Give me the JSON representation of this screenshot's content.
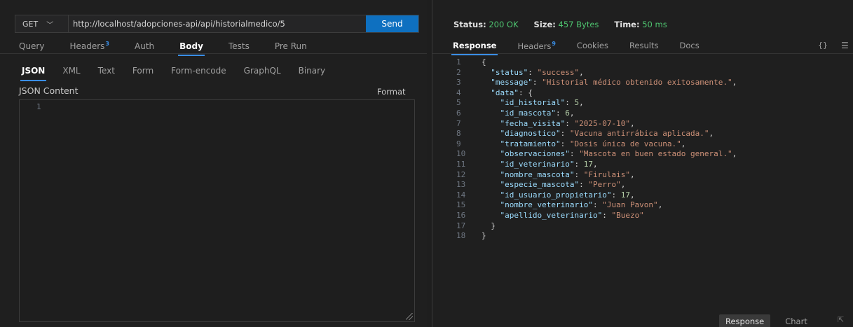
{
  "request": {
    "method": "GET",
    "url": "http://localhost/adopciones-api/api/historialmedico/5",
    "send_label": "Send",
    "tabs": [
      {
        "label": "Query"
      },
      {
        "label": "Headers",
        "badge": "3"
      },
      {
        "label": "Auth"
      },
      {
        "label": "Body",
        "active": true
      },
      {
        "label": "Tests"
      },
      {
        "label": "Pre Run"
      }
    ],
    "body_tabs": [
      {
        "label": "JSON",
        "active": true
      },
      {
        "label": "XML"
      },
      {
        "label": "Text"
      },
      {
        "label": "Form"
      },
      {
        "label": "Form-encode"
      },
      {
        "label": "GraphQL"
      },
      {
        "label": "Binary"
      }
    ],
    "json_content_label": "JSON Content",
    "format_label": "Format",
    "editor_line_number": "1"
  },
  "response": {
    "status_label": "Status:",
    "status_value": "200 OK",
    "size_label": "Size:",
    "size_value": "457 Bytes",
    "time_label": "Time:",
    "time_value": "50 ms",
    "tabs": [
      {
        "label": "Response",
        "active": true
      },
      {
        "label": "Headers",
        "badge": "9"
      },
      {
        "label": "Cookies"
      },
      {
        "label": "Results"
      },
      {
        "label": "Docs"
      }
    ],
    "braces_icon": "{}",
    "menu_icon": "hamburger-icon",
    "bottom_tabs": [
      {
        "label": "Response",
        "active": true
      },
      {
        "label": "Chart"
      }
    ],
    "body_lines": [
      {
        "n": "1",
        "indent": 0,
        "tokens": [
          {
            "t": "p",
            "v": "{"
          }
        ]
      },
      {
        "n": "2",
        "indent": 1,
        "tokens": [
          {
            "t": "k",
            "v": "\"status\""
          },
          {
            "t": "p",
            "v": ": "
          },
          {
            "t": "s",
            "v": "\"success\""
          },
          {
            "t": "p",
            "v": ","
          }
        ]
      },
      {
        "n": "3",
        "indent": 1,
        "tokens": [
          {
            "t": "k",
            "v": "\"message\""
          },
          {
            "t": "p",
            "v": ": "
          },
          {
            "t": "s",
            "v": "\"Historial médico obtenido exitosamente.\""
          },
          {
            "t": "p",
            "v": ","
          }
        ]
      },
      {
        "n": "4",
        "indent": 1,
        "tokens": [
          {
            "t": "k",
            "v": "\"data\""
          },
          {
            "t": "p",
            "v": ": {"
          }
        ]
      },
      {
        "n": "5",
        "indent": 2,
        "tokens": [
          {
            "t": "k",
            "v": "\"id_historial\""
          },
          {
            "t": "p",
            "v": ": "
          },
          {
            "t": "num",
            "v": "5"
          },
          {
            "t": "p",
            "v": ","
          }
        ]
      },
      {
        "n": "6",
        "indent": 2,
        "tokens": [
          {
            "t": "k",
            "v": "\"id_mascota\""
          },
          {
            "t": "p",
            "v": ": "
          },
          {
            "t": "num",
            "v": "6"
          },
          {
            "t": "p",
            "v": ","
          }
        ]
      },
      {
        "n": "7",
        "indent": 2,
        "tokens": [
          {
            "t": "k",
            "v": "\"fecha_visita\""
          },
          {
            "t": "p",
            "v": ": "
          },
          {
            "t": "s",
            "v": "\"2025-07-10\""
          },
          {
            "t": "p",
            "v": ","
          }
        ]
      },
      {
        "n": "8",
        "indent": 2,
        "tokens": [
          {
            "t": "k",
            "v": "\"diagnostico\""
          },
          {
            "t": "p",
            "v": ": "
          },
          {
            "t": "s",
            "v": "\"Vacuna antirrábica aplicada.\""
          },
          {
            "t": "p",
            "v": ","
          }
        ]
      },
      {
        "n": "9",
        "indent": 2,
        "tokens": [
          {
            "t": "k",
            "v": "\"tratamiento\""
          },
          {
            "t": "p",
            "v": ": "
          },
          {
            "t": "s",
            "v": "\"Dosis única de vacuna.\""
          },
          {
            "t": "p",
            "v": ","
          }
        ]
      },
      {
        "n": "10",
        "indent": 2,
        "tokens": [
          {
            "t": "k",
            "v": "\"observaciones\""
          },
          {
            "t": "p",
            "v": ": "
          },
          {
            "t": "s",
            "v": "\"Mascota en buen estado general.\""
          },
          {
            "t": "p",
            "v": ","
          }
        ]
      },
      {
        "n": "11",
        "indent": 2,
        "tokens": [
          {
            "t": "k",
            "v": "\"id_veterinario\""
          },
          {
            "t": "p",
            "v": ": "
          },
          {
            "t": "num",
            "v": "17"
          },
          {
            "t": "p",
            "v": ","
          }
        ]
      },
      {
        "n": "12",
        "indent": 2,
        "tokens": [
          {
            "t": "k",
            "v": "\"nombre_mascota\""
          },
          {
            "t": "p",
            "v": ": "
          },
          {
            "t": "s",
            "v": "\"Firulais\""
          },
          {
            "t": "p",
            "v": ","
          }
        ]
      },
      {
        "n": "13",
        "indent": 2,
        "tokens": [
          {
            "t": "k",
            "v": "\"especie_mascota\""
          },
          {
            "t": "p",
            "v": ": "
          },
          {
            "t": "s",
            "v": "\"Perro\""
          },
          {
            "t": "p",
            "v": ","
          }
        ]
      },
      {
        "n": "14",
        "indent": 2,
        "tokens": [
          {
            "t": "k",
            "v": "\"id_usuario_propietario\""
          },
          {
            "t": "p",
            "v": ": "
          },
          {
            "t": "num",
            "v": "17"
          },
          {
            "t": "p",
            "v": ","
          }
        ]
      },
      {
        "n": "15",
        "indent": 2,
        "tokens": [
          {
            "t": "k",
            "v": "\"nombre_veterinario\""
          },
          {
            "t": "p",
            "v": ": "
          },
          {
            "t": "s",
            "v": "\"Juan Pavon\""
          },
          {
            "t": "p",
            "v": ","
          }
        ]
      },
      {
        "n": "16",
        "indent": 2,
        "tokens": [
          {
            "t": "k",
            "v": "\"apellido_veterinario\""
          },
          {
            "t": "p",
            "v": ": "
          },
          {
            "t": "s",
            "v": "\"Buezo\""
          }
        ]
      },
      {
        "n": "17",
        "indent": 1,
        "tokens": [
          {
            "t": "p",
            "v": "}"
          }
        ]
      },
      {
        "n": "18",
        "indent": 0,
        "tokens": [
          {
            "t": "p",
            "v": "}"
          }
        ]
      }
    ]
  }
}
